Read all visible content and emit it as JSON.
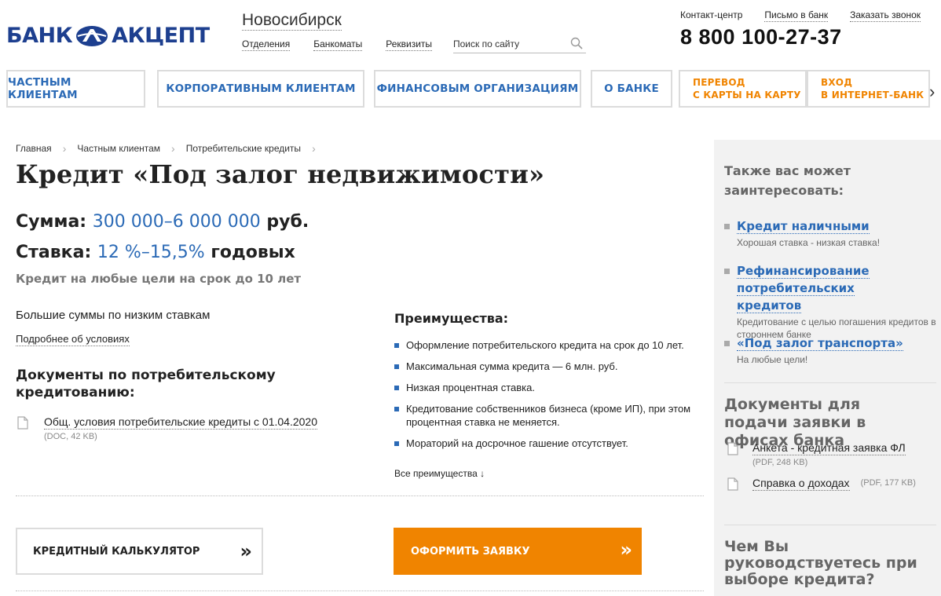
{
  "header": {
    "logo_left": "БАНК",
    "logo_right": "АКЦЕПТ",
    "city": "Новосибирск",
    "links": [
      "Отделения",
      "Банкоматы",
      "Реквизиты"
    ],
    "search_placeholder": "Поиск по сайту",
    "top_links": [
      "Контакт-центр",
      "Письмо в банк",
      "Заказать звонок"
    ],
    "phone": "8 800 100-27-37"
  },
  "nav": {
    "items": [
      "ЧАСТНЫМ КЛИЕНТАМ",
      "КОРПОРАТИВНЫМ КЛИЕНТАМ",
      "ФИНАНСОВЫМ ОРГАНИЗАЦИЯМ",
      "О БАНКЕ"
    ],
    "transfer": [
      "ПЕРЕВОД",
      "С КАРТЫ НА КАРТУ"
    ],
    "login": [
      "ВХОД",
      "В ИНТЕРНЕТ-БАНК"
    ],
    "arrow": "›"
  },
  "breadcrumbs": [
    "Главная",
    "Частным клиентам",
    "Потребительские кредиты"
  ],
  "page": {
    "title": "Кредит «Под залог недвижимости»",
    "sum_label": "Сумма:",
    "sum_value": "300 000–6 000 000",
    "sum_unit": "руб.",
    "rate_label": "Ставка:",
    "rate_value": "12 %–15,5%",
    "rate_unit": "годовых",
    "subtitle": "Кредит на любые цели на срок до 10 лет",
    "intro": "Большие суммы по низким ставкам",
    "more_conditions": "Подробнее об условиях",
    "docs_title": "Документы по потребительскому кредитованию:",
    "doc": {
      "name": "Общ. условия потребительские кредиты с 01.04.2020",
      "meta": "(DOC, 42 KB)"
    }
  },
  "advantages": {
    "title": "Преимущества:",
    "items": [
      "Оформление потребительского кредита на срок до 10 лет.",
      "Максимальная сумма кредита — 6 млн. руб.",
      "Низкая процентная ставка.",
      "Кредитование собственников бизнеса (кроме ИП), при этом процентная ставка не меняется.",
      "Мораторий на досрочное гашение отсутствует."
    ],
    "more": "Все преимущества ↓"
  },
  "buttons": {
    "calculator": "КРЕДИТНЫЙ КАЛЬКУЛЯТОР",
    "apply": "ОФОРМИТЬ ЗАЯВКУ",
    "chevron": "»"
  },
  "sidebar": {
    "interest_title": "Также вас может заинтересовать:",
    "items": [
      {
        "title": "Кредит наличными",
        "desc": "Хорошая ставка - низкая ставка!"
      },
      {
        "title": "Рефинансирование потребительских кредитов",
        "desc": "Кредитование с целью погашения кредитов в стороннем банке"
      },
      {
        "title": "«Под залог транспорта»",
        "desc": "На любые цели!"
      }
    ],
    "docs_title": "Документы для подачи заявки в офисах банка",
    "docs": [
      {
        "name": "Анкета - кредитная заявка ФЛ",
        "meta": "(PDF, 248 KB)"
      },
      {
        "name": "Справка о доходах",
        "meta": "(PDF, 177 KB)"
      }
    ],
    "question_title": "Чем Вы руководствуетесь при выборе кредита?"
  },
  "colors": {
    "brand_blue": "#2b6ab6",
    "logo_blue": "#1d3f8f",
    "accent_orange": "#f08400",
    "sidebar_bg": "#f2f2f2"
  }
}
